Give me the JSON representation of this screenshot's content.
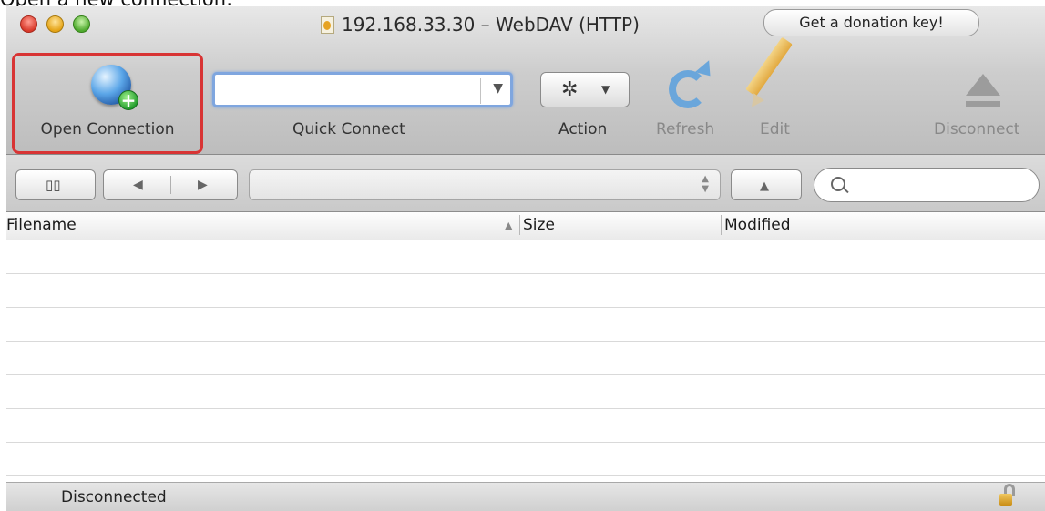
{
  "caption": "Open a new connection:",
  "window": {
    "title": "192.168.33.30 – WebDAV (HTTP)",
    "donation_label": "Get a donation key!"
  },
  "toolbar": {
    "open_connection_label": "Open Connection",
    "quick_connect_label": "Quick Connect",
    "quick_connect_value": "",
    "action_label": "Action",
    "refresh_label": "Refresh",
    "edit_label": "Edit",
    "disconnect_label": "Disconnect"
  },
  "browser": {
    "columns": [
      "Filename",
      "Size",
      "Modified"
    ],
    "sort": "ascending",
    "rows": []
  },
  "status": {
    "text": "Disconnected"
  },
  "icons": [
    "bookmark-icon",
    "back-arrow-icon",
    "forward-arrow-icon",
    "up-arrow-icon",
    "search-icon",
    "gear-icon",
    "refresh-icon",
    "pencil-icon",
    "eject-icon",
    "globe-icon",
    "lock-icon"
  ],
  "colors": {
    "highlight_border": "#d83434",
    "focus_ring": "#7fa6df"
  }
}
